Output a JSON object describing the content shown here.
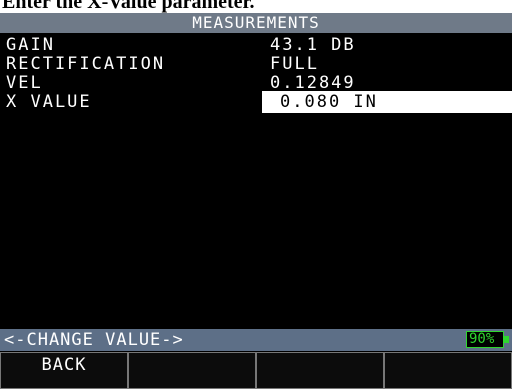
{
  "doc_caption": "Enter the X-Value parameter.",
  "title": "MEASUREMENTS",
  "menu": [
    {
      "label": "GAIN",
      "value": "43.1 DB"
    },
    {
      "label": "RECTIFICATION",
      "value": "FULL"
    },
    {
      "label": "VEL",
      "value": "0.12849"
    },
    {
      "label": "X VALUE",
      "value": "0.080 IN",
      "selected": true
    }
  ],
  "status_text": "<-CHANGE VALUE->",
  "battery": {
    "level_percent": 90,
    "label": "90%"
  },
  "softkeys": [
    "BACK",
    "",
    "",
    ""
  ],
  "colors": {
    "title_bg": "#6f7a88",
    "status_bg": "#5d6f87",
    "battery": "#2fd62f",
    "selected_bg": "#ffffff"
  }
}
